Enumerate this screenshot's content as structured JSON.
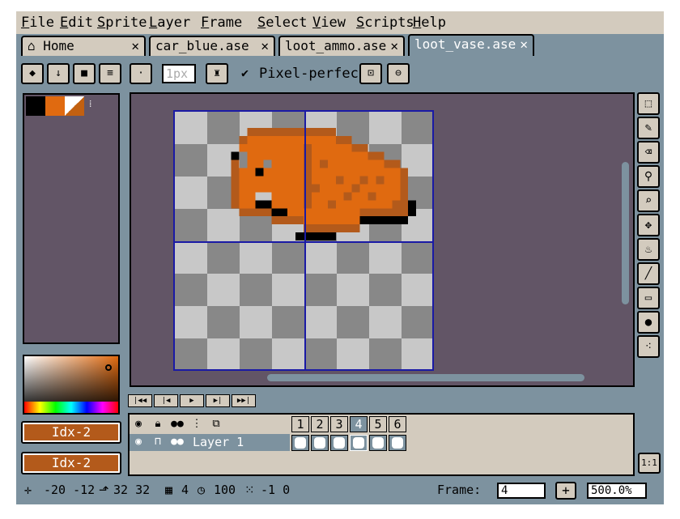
{
  "menu": [
    "File",
    "Edit",
    "Sprite",
    "Layer",
    "Frame",
    "Select",
    "View",
    "Scripts",
    "Help"
  ],
  "tabs": [
    {
      "label": "Home",
      "icon": "home-icon"
    },
    {
      "label": "car_blue.ase"
    },
    {
      "label": "loot_ammo.ase"
    },
    {
      "label": "loot_vase.ase",
      "active": true
    }
  ],
  "toolbar": {
    "brush_size": "1px",
    "pixel_perfect_label": "Pixel-perfect",
    "pixel_perfect_checked": true
  },
  "palette": {
    "colors": [
      "#000000",
      "#e06a10",
      "#c26010"
    ]
  },
  "color_buttons": {
    "fg": "Idx-2",
    "bg": "Idx-2"
  },
  "timeline": {
    "frames": [
      "1",
      "2",
      "3",
      "4",
      "5",
      "6"
    ],
    "active_frame": "4",
    "layers": [
      {
        "name": "Layer 1"
      }
    ]
  },
  "onetoone_label": "1:1",
  "status": {
    "cursor": "-20  -12",
    "size": "32  32",
    "frame_count": "4",
    "duration": "100",
    "grid": "-1  0",
    "frame_label": "Frame:",
    "frame_value": "4",
    "zoom_value": "500.0%"
  },
  "colors": {
    "accent": "#7d929f",
    "panel": "#d3cbbe",
    "editor_bg": "#625566",
    "sprite_orange": "#e06a10",
    "sprite_dark": "#b35a1b"
  }
}
